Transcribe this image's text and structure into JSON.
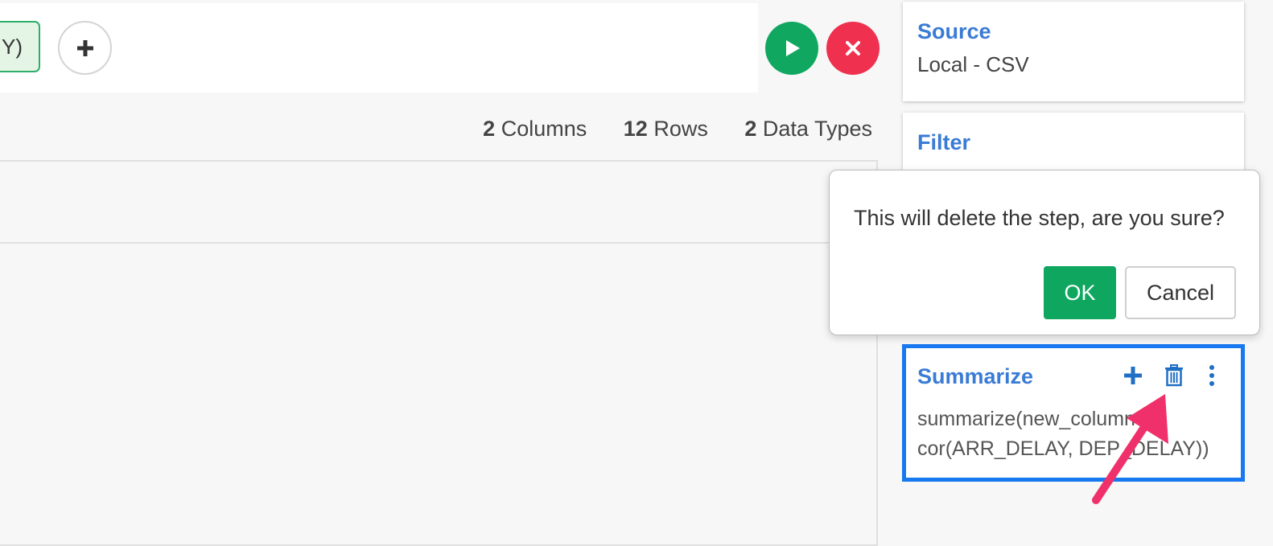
{
  "toolbar": {
    "chip_label": "Y)",
    "add_label": "+"
  },
  "stats": {
    "columns_count": "2",
    "columns_label": "Columns",
    "rows_count": "12",
    "rows_label": "Rows",
    "types_count": "2",
    "types_label": "Data Types"
  },
  "steps": [
    {
      "title": "Source",
      "subtitle": "Local - CSV"
    },
    {
      "title": "Filter",
      "subtitle": ""
    },
    {
      "title": "Summarize",
      "code_line1": "summarize(new_column =",
      "code_line2": "cor(ARR_DELAY, DEP_DELAY))"
    }
  ],
  "popover": {
    "message": "This will delete the step, are you sure?",
    "ok_label": "OK",
    "cancel_label": "Cancel"
  },
  "colors": {
    "accent_blue": "#3a7bd5",
    "selected_border": "#1878f0",
    "run_green": "#10a860",
    "cancel_red": "#f0304f",
    "annotation_pink": "#f0306a"
  },
  "icons": {
    "run": "play-icon",
    "cancel": "close-icon",
    "add_step": "plus-icon",
    "delete_step": "trash-icon",
    "more": "kebab-icon"
  }
}
